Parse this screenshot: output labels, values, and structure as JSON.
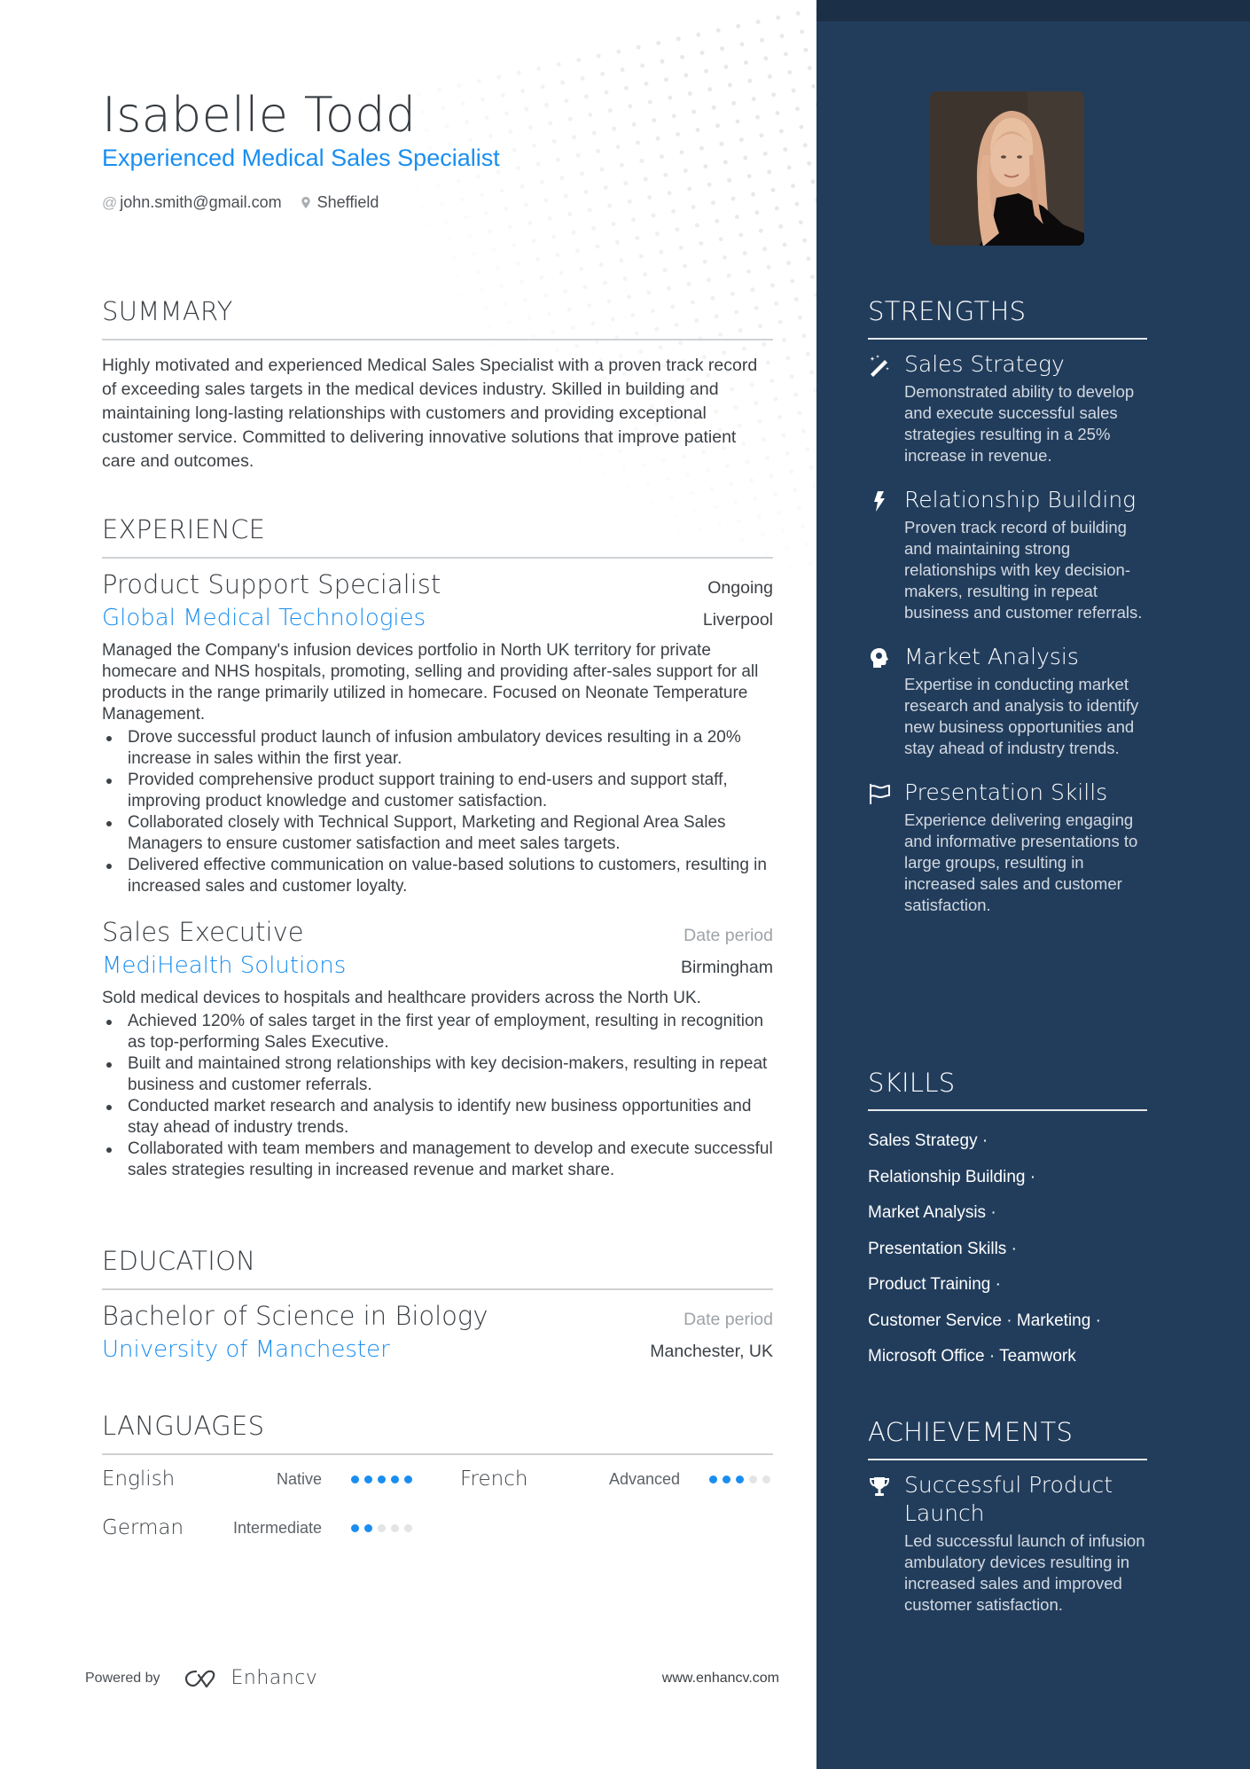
{
  "header": {
    "name": "Isabelle Todd",
    "headline": "Experienced Medical Sales Specialist",
    "email": "john.smith@gmail.com",
    "location": "Sheffield",
    "email_icon": "at-icon",
    "location_icon": "map-pin-icon"
  },
  "summary": {
    "title": "SUMMARY",
    "text": "Highly motivated and experienced Medical Sales Specialist with a proven track record of exceeding sales targets in the medical devices industry. Skilled in building and maintaining long-lasting relationships with customers and providing exceptional customer service. Committed to delivering innovative solutions that improve patient care and outcomes."
  },
  "experience": {
    "title": "EXPERIENCE",
    "jobs": [
      {
        "role": "Product Support Specialist",
        "date": "Ongoing",
        "company": "Global Medical Technologies",
        "location": "Liverpool",
        "description": "Managed the Company's infusion devices portfolio in North UK territory for private homecare and NHS hospitals, promoting, selling and providing after-sales support for all products in the range primarily utilized in homecare. Focused on Neonate Temperature Management.",
        "bullets": [
          "Drove successful product launch of infusion ambulatory devices resulting in a 20% increase in sales within the first year.",
          "Provided comprehensive product support training to end-users and support staff, improving product knowledge and customer satisfaction.",
          "Collaborated closely with Technical Support, Marketing and Regional Area Sales Managers to ensure customer satisfaction and meet sales targets.",
          "Delivered effective communication on value-based solutions to customers, resulting in increased sales and customer loyalty."
        ]
      },
      {
        "role": "Sales Executive",
        "date": "Date period",
        "company": "MediHealth Solutions",
        "location": "Birmingham",
        "description": "Sold medical devices to hospitals and healthcare providers across the North UK.",
        "bullets": [
          "Achieved 120% of sales target in the first year of employment, resulting in recognition as top-performing Sales Executive.",
          "Built and maintained strong relationships with key decision-makers, resulting in repeat business and customer referrals.",
          "Conducted market research and analysis to identify new business opportunities and stay ahead of industry trends.",
          "Collaborated with team members and management to develop and execute successful sales strategies resulting in increased revenue and market share."
        ]
      }
    ]
  },
  "education": {
    "title": "EDUCATION",
    "degree": "Bachelor of Science in Biology",
    "date": "Date period",
    "school": "University of Manchester",
    "location": "Manchester, UK"
  },
  "languages": {
    "title": "LANGUAGES",
    "items": [
      {
        "name": "English",
        "level": "Native",
        "rating": 5,
        "max": 5
      },
      {
        "name": "French",
        "level": "Advanced",
        "rating": 3,
        "max": 5
      },
      {
        "name": "German",
        "level": "Intermediate",
        "rating": 2,
        "max": 5
      }
    ]
  },
  "footer": {
    "powered_by": "Powered by",
    "brand": "Enhancv",
    "url": "www.enhancv.com"
  },
  "sidebar": {
    "photo_alt": "Profile photo",
    "strengths": {
      "title": "STRENGTHS",
      "items": [
        {
          "icon": "magic-wand-icon",
          "title": "Sales Strategy",
          "description": "Demonstrated ability to develop and execute successful sales strategies resulting in a 25% increase in revenue."
        },
        {
          "icon": "lightning-bolt-icon",
          "title": "Relationship Building",
          "description": "Proven track record of building and maintaining strong relationships with key decision-makers, resulting in repeat business and customer referrals."
        },
        {
          "icon": "head-brain-icon",
          "title": "Market Analysis",
          "description": "Expertise in conducting market research and analysis to identify new business opportunities and stay ahead of industry trends."
        },
        {
          "icon": "flag-icon",
          "title": "Presentation Skills",
          "description": "Experience delivering engaging and informative presentations to large groups, resulting in increased sales and customer satisfaction."
        }
      ]
    },
    "skills": {
      "title": "SKILLS",
      "lines": [
        "Sales Strategy ·",
        "Relationship Building ·",
        "Market Analysis ·",
        "Presentation Skills ·",
        "Product Training ·",
        "Customer Service · Marketing ·",
        "Microsoft Office · Teamwork"
      ]
    },
    "achievements": {
      "title": "ACHIEVEMENTS",
      "items": [
        {
          "icon": "trophy-icon",
          "title": "Successful Product Launch",
          "description": "Led successful launch of infusion ambulatory devices resulting in increased sales and improved customer satisfaction."
        }
      ]
    }
  },
  "colors": {
    "accent": "#1a8ef0",
    "sidebar_bg": "#223d5c",
    "sidebar_topband": "#1b2f47",
    "text": "#3c4146",
    "muted": "#9ea3a8",
    "dot_inactive": "#e2e4e6"
  }
}
